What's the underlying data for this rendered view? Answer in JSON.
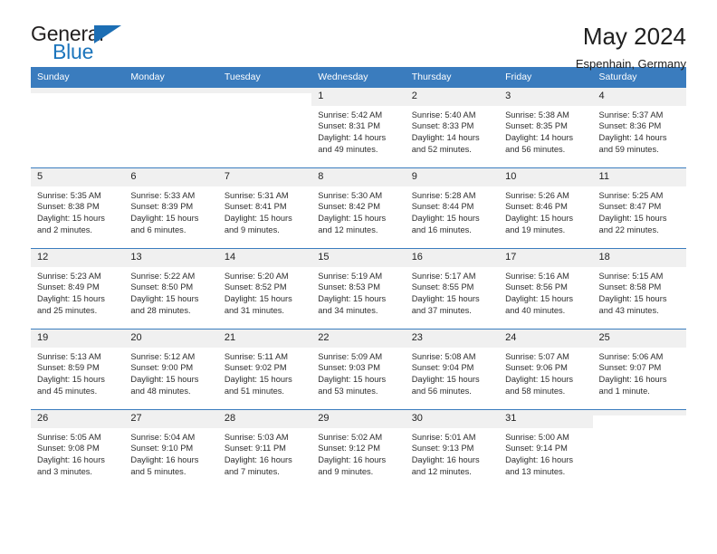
{
  "brand": {
    "name_top": "General",
    "name_bottom": "Blue",
    "triangle_color": "#1c6eb4",
    "accent_color": "#3a7cbe"
  },
  "header": {
    "title": "May 2024",
    "subtitle": "Espenhain, Germany"
  },
  "calendar": {
    "weekdays": [
      "Sunday",
      "Monday",
      "Tuesday",
      "Wednesday",
      "Thursday",
      "Friday",
      "Saturday"
    ],
    "labels": {
      "sunrise": "Sunrise:",
      "sunset": "Sunset:",
      "daylight": "Daylight:"
    },
    "weeks": [
      [
        {
          "day": "",
          "empty": true
        },
        {
          "day": "",
          "empty": true
        },
        {
          "day": "",
          "empty": true
        },
        {
          "day": "1",
          "sunrise": "Sunrise: 5:42 AM",
          "sunset": "Sunset: 8:31 PM",
          "daylight1": "Daylight: 14 hours",
          "daylight2": "and 49 minutes."
        },
        {
          "day": "2",
          "sunrise": "Sunrise: 5:40 AM",
          "sunset": "Sunset: 8:33 PM",
          "daylight1": "Daylight: 14 hours",
          "daylight2": "and 52 minutes."
        },
        {
          "day": "3",
          "sunrise": "Sunrise: 5:38 AM",
          "sunset": "Sunset: 8:35 PM",
          "daylight1": "Daylight: 14 hours",
          "daylight2": "and 56 minutes."
        },
        {
          "day": "4",
          "sunrise": "Sunrise: 5:37 AM",
          "sunset": "Sunset: 8:36 PM",
          "daylight1": "Daylight: 14 hours",
          "daylight2": "and 59 minutes."
        }
      ],
      [
        {
          "day": "5",
          "sunrise": "Sunrise: 5:35 AM",
          "sunset": "Sunset: 8:38 PM",
          "daylight1": "Daylight: 15 hours",
          "daylight2": "and 2 minutes."
        },
        {
          "day": "6",
          "sunrise": "Sunrise: 5:33 AM",
          "sunset": "Sunset: 8:39 PM",
          "daylight1": "Daylight: 15 hours",
          "daylight2": "and 6 minutes."
        },
        {
          "day": "7",
          "sunrise": "Sunrise: 5:31 AM",
          "sunset": "Sunset: 8:41 PM",
          "daylight1": "Daylight: 15 hours",
          "daylight2": "and 9 minutes."
        },
        {
          "day": "8",
          "sunrise": "Sunrise: 5:30 AM",
          "sunset": "Sunset: 8:42 PM",
          "daylight1": "Daylight: 15 hours",
          "daylight2": "and 12 minutes."
        },
        {
          "day": "9",
          "sunrise": "Sunrise: 5:28 AM",
          "sunset": "Sunset: 8:44 PM",
          "daylight1": "Daylight: 15 hours",
          "daylight2": "and 16 minutes."
        },
        {
          "day": "10",
          "sunrise": "Sunrise: 5:26 AM",
          "sunset": "Sunset: 8:46 PM",
          "daylight1": "Daylight: 15 hours",
          "daylight2": "and 19 minutes."
        },
        {
          "day": "11",
          "sunrise": "Sunrise: 5:25 AM",
          "sunset": "Sunset: 8:47 PM",
          "daylight1": "Daylight: 15 hours",
          "daylight2": "and 22 minutes."
        }
      ],
      [
        {
          "day": "12",
          "sunrise": "Sunrise: 5:23 AM",
          "sunset": "Sunset: 8:49 PM",
          "daylight1": "Daylight: 15 hours",
          "daylight2": "and 25 minutes."
        },
        {
          "day": "13",
          "sunrise": "Sunrise: 5:22 AM",
          "sunset": "Sunset: 8:50 PM",
          "daylight1": "Daylight: 15 hours",
          "daylight2": "and 28 minutes."
        },
        {
          "day": "14",
          "sunrise": "Sunrise: 5:20 AM",
          "sunset": "Sunset: 8:52 PM",
          "daylight1": "Daylight: 15 hours",
          "daylight2": "and 31 minutes."
        },
        {
          "day": "15",
          "sunrise": "Sunrise: 5:19 AM",
          "sunset": "Sunset: 8:53 PM",
          "daylight1": "Daylight: 15 hours",
          "daylight2": "and 34 minutes."
        },
        {
          "day": "16",
          "sunrise": "Sunrise: 5:17 AM",
          "sunset": "Sunset: 8:55 PM",
          "daylight1": "Daylight: 15 hours",
          "daylight2": "and 37 minutes."
        },
        {
          "day": "17",
          "sunrise": "Sunrise: 5:16 AM",
          "sunset": "Sunset: 8:56 PM",
          "daylight1": "Daylight: 15 hours",
          "daylight2": "and 40 minutes."
        },
        {
          "day": "18",
          "sunrise": "Sunrise: 5:15 AM",
          "sunset": "Sunset: 8:58 PM",
          "daylight1": "Daylight: 15 hours",
          "daylight2": "and 43 minutes."
        }
      ],
      [
        {
          "day": "19",
          "sunrise": "Sunrise: 5:13 AM",
          "sunset": "Sunset: 8:59 PM",
          "daylight1": "Daylight: 15 hours",
          "daylight2": "and 45 minutes."
        },
        {
          "day": "20",
          "sunrise": "Sunrise: 5:12 AM",
          "sunset": "Sunset: 9:00 PM",
          "daylight1": "Daylight: 15 hours",
          "daylight2": "and 48 minutes."
        },
        {
          "day": "21",
          "sunrise": "Sunrise: 5:11 AM",
          "sunset": "Sunset: 9:02 PM",
          "daylight1": "Daylight: 15 hours",
          "daylight2": "and 51 minutes."
        },
        {
          "day": "22",
          "sunrise": "Sunrise: 5:09 AM",
          "sunset": "Sunset: 9:03 PM",
          "daylight1": "Daylight: 15 hours",
          "daylight2": "and 53 minutes."
        },
        {
          "day": "23",
          "sunrise": "Sunrise: 5:08 AM",
          "sunset": "Sunset: 9:04 PM",
          "daylight1": "Daylight: 15 hours",
          "daylight2": "and 56 minutes."
        },
        {
          "day": "24",
          "sunrise": "Sunrise: 5:07 AM",
          "sunset": "Sunset: 9:06 PM",
          "daylight1": "Daylight: 15 hours",
          "daylight2": "and 58 minutes."
        },
        {
          "day": "25",
          "sunrise": "Sunrise: 5:06 AM",
          "sunset": "Sunset: 9:07 PM",
          "daylight1": "Daylight: 16 hours",
          "daylight2": "and 1 minute."
        }
      ],
      [
        {
          "day": "26",
          "sunrise": "Sunrise: 5:05 AM",
          "sunset": "Sunset: 9:08 PM",
          "daylight1": "Daylight: 16 hours",
          "daylight2": "and 3 minutes."
        },
        {
          "day": "27",
          "sunrise": "Sunrise: 5:04 AM",
          "sunset": "Sunset: 9:10 PM",
          "daylight1": "Daylight: 16 hours",
          "daylight2": "and 5 minutes."
        },
        {
          "day": "28",
          "sunrise": "Sunrise: 5:03 AM",
          "sunset": "Sunset: 9:11 PM",
          "daylight1": "Daylight: 16 hours",
          "daylight2": "and 7 minutes."
        },
        {
          "day": "29",
          "sunrise": "Sunrise: 5:02 AM",
          "sunset": "Sunset: 9:12 PM",
          "daylight1": "Daylight: 16 hours",
          "daylight2": "and 9 minutes."
        },
        {
          "day": "30",
          "sunrise": "Sunrise: 5:01 AM",
          "sunset": "Sunset: 9:13 PM",
          "daylight1": "Daylight: 16 hours",
          "daylight2": "and 12 minutes."
        },
        {
          "day": "31",
          "sunrise": "Sunrise: 5:00 AM",
          "sunset": "Sunset: 9:14 PM",
          "daylight1": "Daylight: 16 hours",
          "daylight2": "and 13 minutes."
        },
        {
          "day": "",
          "empty": true
        }
      ]
    ]
  }
}
